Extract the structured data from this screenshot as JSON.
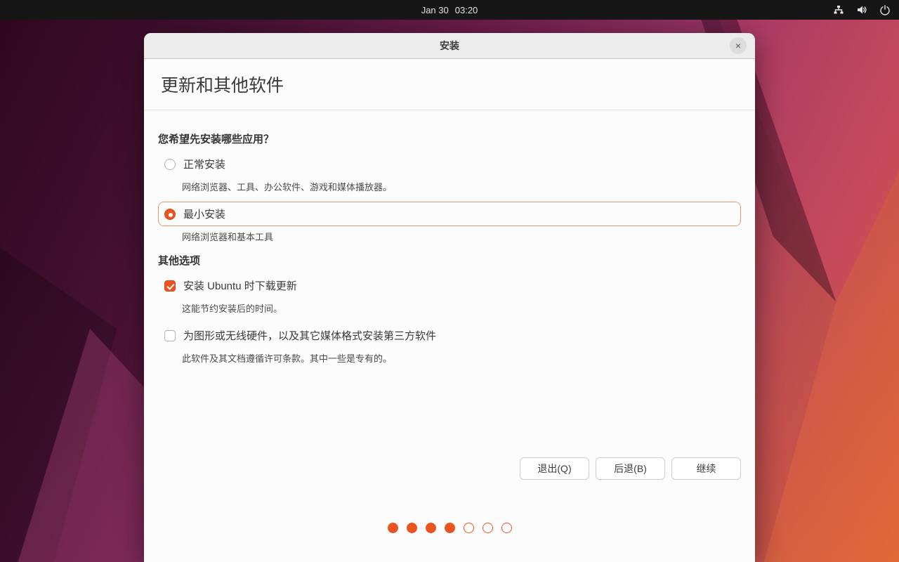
{
  "topbar": {
    "date": "Jan 30",
    "time": "03:20",
    "icons": [
      "network",
      "volume",
      "power"
    ]
  },
  "window": {
    "title": "安装",
    "close_label": "×"
  },
  "page": {
    "heading": "更新和其他软件"
  },
  "apps": {
    "question": "您希望先安装哪些应用？",
    "options": [
      {
        "label": "正常安装",
        "description": "网络浏览器、工具、办公软件、游戏和媒体播放器。",
        "selected": false
      },
      {
        "label": "最小安装",
        "description": "网络浏览器和基本工具",
        "selected": true
      }
    ]
  },
  "other": {
    "title": "其他选项",
    "options": [
      {
        "label": "安装 Ubuntu 时下载更新",
        "description": "这能节约安装后的时间。",
        "checked": true
      },
      {
        "label": "为图形或无线硬件，以及其它媒体格式安装第三方软件",
        "description": "此软件及其文档遵循许可条款。其中一些是专有的。",
        "checked": false
      }
    ]
  },
  "footer": {
    "quit": "退出(Q)",
    "back": "后退(B)",
    "continue": "继续"
  },
  "progress": {
    "total": 7,
    "current": 4
  },
  "colors": {
    "accent": "#E95420",
    "selected_border": "#E59C76"
  }
}
